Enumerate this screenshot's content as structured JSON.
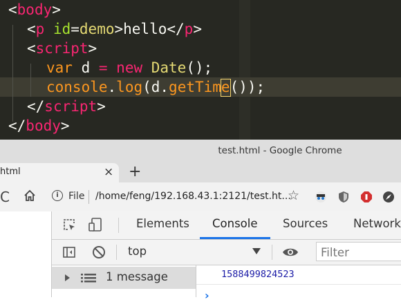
{
  "editor": {
    "lines": [
      {
        "t1": "<",
        "t2": "body",
        "t3": ">"
      },
      {
        "t1": "<",
        "t2": "p",
        "t3": " id",
        "t4": "=",
        "t5": "demo",
        "t6": ">",
        "t7": "hello",
        "t8": "</",
        "t9": "p",
        "t10": ">"
      },
      {
        "t1": "<",
        "t2": "script",
        "t3": ">"
      },
      {
        "t1": "var",
        "t2": " d ",
        "t3": "=",
        "t4": " new ",
        "t5": "Date",
        "t6": "();"
      },
      {
        "t1": "console",
        "t2": ".",
        "t3": "log",
        "t4": "(d.",
        "t5": "getTim",
        "t6": "e",
        "t7": "());"
      },
      {
        "t1": "</",
        "t2": "script",
        "t3": ">"
      },
      {
        "t1": "</",
        "t2": "body",
        "t3": ">"
      }
    ]
  },
  "window": {
    "title": "test.html - Google Chrome"
  },
  "tab": {
    "title": "html",
    "close": "×",
    "new_tab": "+"
  },
  "toolbar": {
    "reload": "C",
    "scheme_label": "File",
    "url": "/home/feng/192.168.43.1:2121/test.ht...",
    "star": "☆"
  },
  "devtools": {
    "tabs": [
      "Elements",
      "Console",
      "Sources",
      "Network"
    ],
    "active_tab": "Console",
    "context": "top",
    "filter_placeholder": "Filter",
    "sidebar": {
      "messages_label": "1 message"
    },
    "console": {
      "output": "1588499824523",
      "prompt": "›"
    }
  },
  "colors": {
    "accent": "#1a73e8",
    "editor_bg": "#272822",
    "output": "#1a1aa6"
  }
}
